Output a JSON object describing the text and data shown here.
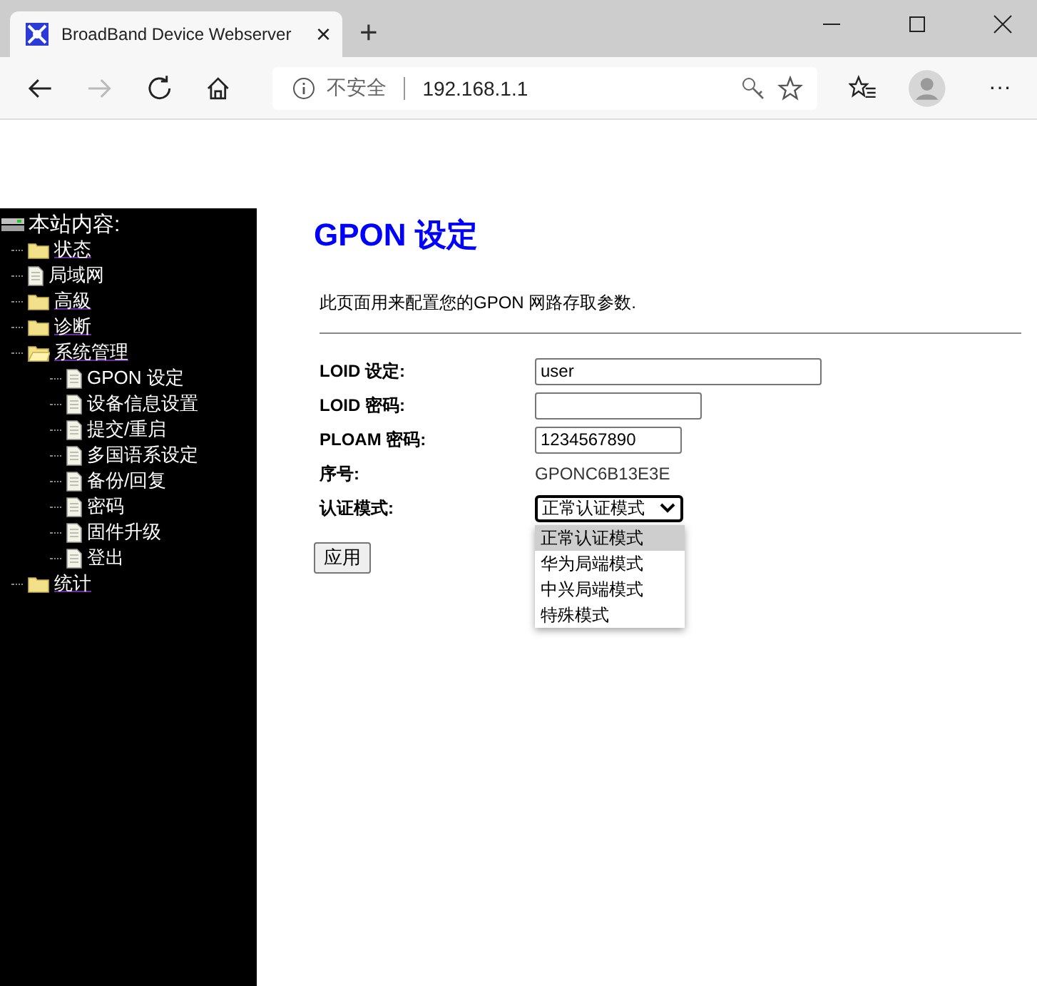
{
  "browser": {
    "tab_title": "BroadBand Device Webserver",
    "tab_close": "×",
    "new_tab": "+",
    "security_label": "不安全",
    "url": "192.168.1.1",
    "more": "···"
  },
  "sidebar": {
    "title": "本站内容:",
    "items": [
      {
        "label": "状态",
        "kind": "folder"
      },
      {
        "label": "局域网",
        "kind": "page"
      },
      {
        "label": "高級",
        "kind": "folder"
      },
      {
        "label": "诊断",
        "kind": "folder"
      },
      {
        "label": "系统管理",
        "kind": "open-folder",
        "children": [
          {
            "label": "GPON 设定",
            "kind": "page"
          },
          {
            "label": "设备信息设置",
            "kind": "page"
          },
          {
            "label": "提交/重启",
            "kind": "page"
          },
          {
            "label": "多国语系设定",
            "kind": "page"
          },
          {
            "label": "备份/回复",
            "kind": "page"
          },
          {
            "label": "密码",
            "kind": "page"
          },
          {
            "label": "固件升级",
            "kind": "page"
          },
          {
            "label": "登出",
            "kind": "page"
          }
        ]
      },
      {
        "label": "统计",
        "kind": "folder"
      }
    ]
  },
  "page": {
    "title": "GPON 设定",
    "description": "此页面用来配置您的GPON 网路存取参数.",
    "fields": [
      {
        "label": "LOID 设定:",
        "kind": "input",
        "value": "user"
      },
      {
        "label": "LOID 密码:",
        "kind": "input"
      },
      {
        "label": "PLOAM 密码:",
        "kind": "input",
        "value": "1234567890"
      },
      {
        "label": "序号:",
        "kind": "text",
        "value": "GPONC6B13E3E"
      },
      {
        "label": "认证模式:",
        "kind": "select",
        "value": "正常认证模式",
        "options": [
          {
            "label": "正常认证模式",
            "selected": true
          },
          {
            "label": "华为局端模式",
            "selected": false
          },
          {
            "label": "中兴局端模式",
            "selected": false
          },
          {
            "label": "特殊模式",
            "selected": false
          }
        ]
      }
    ],
    "apply_button": "应用"
  }
}
